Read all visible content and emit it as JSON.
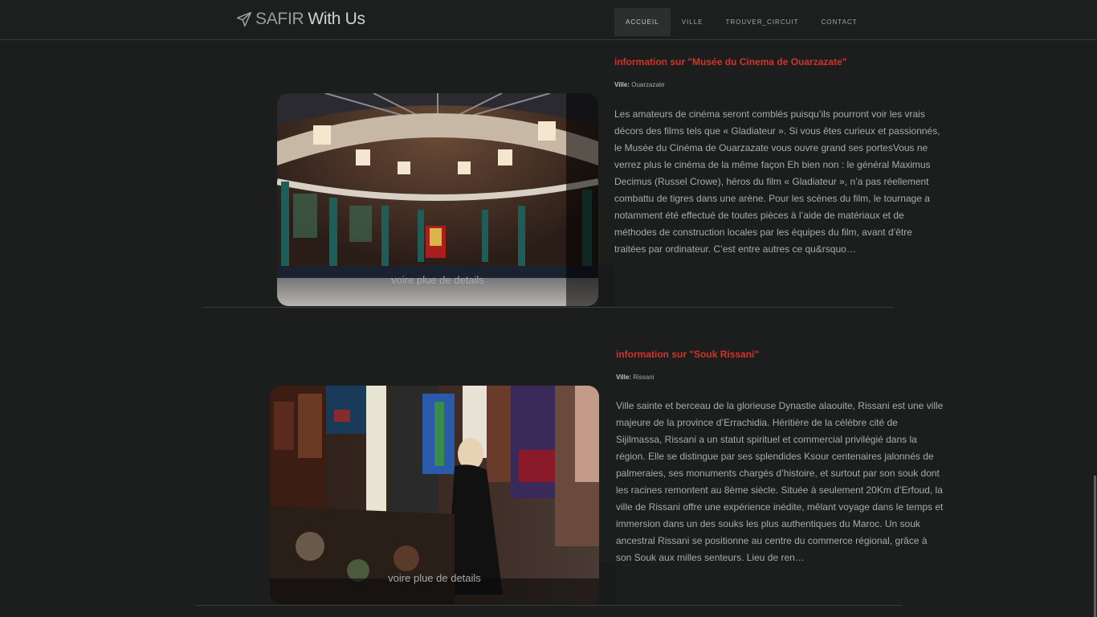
{
  "brand": {
    "part1": "SAFIR",
    "part2": "With Us",
    "icon": "paper-plane-icon"
  },
  "nav": {
    "items": [
      {
        "label": "ACCUEIL",
        "active": true
      },
      {
        "label": "VILLE",
        "active": false
      },
      {
        "label": "TROUVER_CIRCUIT",
        "active": false
      },
      {
        "label": "CONTACT",
        "active": false
      }
    ]
  },
  "cards": [
    {
      "title": "information sur \"Musée du Cinema de Ouarzazate\"",
      "ville_label": "Ville:",
      "ville": "Ouarzazate",
      "link": "voire plue de details",
      "description": "Les amateurs de cinéma seront comblés puisqu’ils pourront voir les vrais décors des films tels que « Gladiateur ». Si vous êtes curieux et passionnés, le Musée du Cinéma de Ouarzazate vous ouvre grand ses portesVous ne verrez plus le cinéma de la même façon Eh bien non : le général Maximus Decimus (Russel Crowe), héros du film « Gladiateur », n’a pas réellement combattu de tigres dans une arène. Pour les scènes du film, le tournage a notamment été effectué de toutes pièces à l’aide de matériaux et de méthodes de construction locales par les équipes du film, avant d’être traitées par ordinateur. C’est entre autres ce qu&rsquo…"
    },
    {
      "title": "information sur \"Souk Rissani\"",
      "ville_label": "Ville:",
      "ville": "Rissani",
      "link": "voire plue de details",
      "description": "Ville sainte et berceau de la glorieuse Dynastie alaouite, Rissani est une ville majeure de la province d’Errachidia. Héritière de la célèbre cité de Sijilmassa, Rissani a un statut spirituel et commercial privilégié dans la région. Elle se distingue par ses splendides Ksour centenaires jalonnés de palmeraies, ses monuments chargés d’histoire, et surtout par son souk dont les racines remontent au 8ème siècle. Située à seulement 20Km d’Erfoud, la ville de Rissani offre une expérience inédite, mêlant voyage dans le temps et immersion dans un des souks les plus authentiques du Maroc. Un souk ancestral Rissani se positionne au centre du commerce régional, grâce à son Souk aux milles senteurs. Lieu de ren…"
    }
  ],
  "colors": {
    "accent": "#d0352d",
    "background": "#1c1d1d"
  }
}
